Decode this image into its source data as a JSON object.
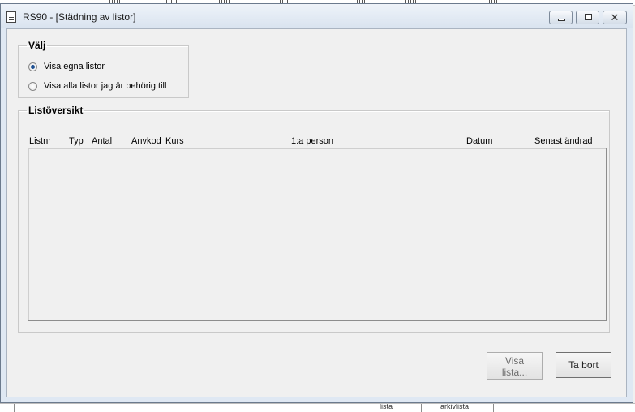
{
  "window": {
    "title": "RS90 - [Städning av listor]",
    "controls": [
      "minimize",
      "maximize",
      "close"
    ],
    "close_glyph": "✕"
  },
  "valj": {
    "legend": "Välj",
    "options": [
      {
        "label": "Visa egna listor",
        "checked": true
      },
      {
        "label": "Visa alla listor jag är behörig till",
        "checked": false
      }
    ]
  },
  "listoversikt": {
    "legend": "Listöversikt",
    "columns": [
      "Listnr",
      "Typ",
      "Antal",
      "Anvkod",
      "Kurs",
      "1:a person",
      "Datum",
      "Senast ändrad"
    ],
    "rows": []
  },
  "buttons": {
    "visa_line1": "Visa",
    "visa_line2": "lista...",
    "ta_bort": "Ta bort"
  },
  "background_app": {
    "bottom_fragments": [
      "lista",
      "arkivlista"
    ]
  },
  "colors": {
    "titlebar": "#dfe8f3",
    "client": "#f0f0f0",
    "radio_selected": "#1d4f91"
  }
}
